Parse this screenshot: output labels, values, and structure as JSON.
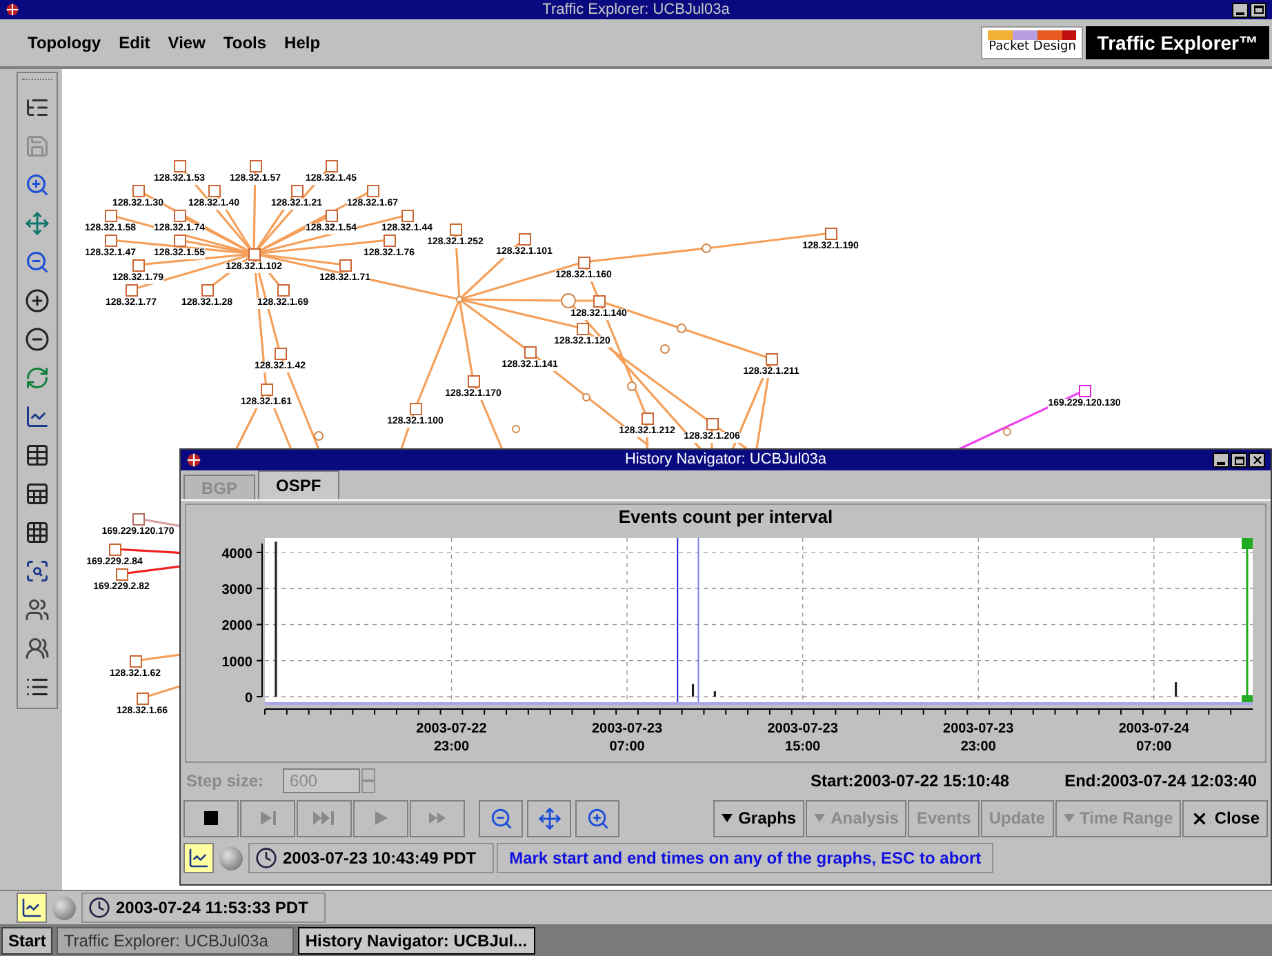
{
  "window": {
    "title": "Traffic Explorer: UCBJul03a"
  },
  "menu": [
    "Topology",
    "Edit",
    "View",
    "Tools",
    "Help"
  ],
  "logo": {
    "company": "Packet Design",
    "product": "Traffic Explorer™"
  },
  "toolbar": [
    {
      "kind": "tree",
      "disabled": false
    },
    {
      "kind": "save",
      "disabled": true
    },
    {
      "kind": "zoom-in",
      "disabled": false
    },
    {
      "kind": "fit",
      "disabled": false
    },
    {
      "kind": "zoom-out",
      "disabled": false
    },
    {
      "kind": "label-add",
      "disabled": false
    },
    {
      "kind": "label-remove",
      "disabled": false
    },
    {
      "kind": "refresh",
      "disabled": false
    },
    {
      "kind": "graph",
      "disabled": false
    },
    {
      "kind": "table",
      "disabled": false
    },
    {
      "kind": "table-link",
      "disabled": false
    },
    {
      "kind": "table-num",
      "disabled": false
    },
    {
      "kind": "inspect",
      "disabled": false
    },
    {
      "kind": "group",
      "disabled": false
    },
    {
      "kind": "group-path",
      "disabled": false
    },
    {
      "kind": "list",
      "disabled": false
    }
  ],
  "topology": {
    "nodes": [
      {
        "label": "128.32.1.102",
        "color": "#cc6633"
      },
      {
        "label": "128.32.1.53",
        "color": "#cc6633"
      },
      {
        "label": "128.32.1.57",
        "color": "#cc6633"
      },
      {
        "label": "128.32.1.45",
        "color": "#cc6633"
      },
      {
        "label": "128.32.1.30",
        "color": "#cc6633"
      },
      {
        "label": "128.32.1.40",
        "color": "#cc6633"
      },
      {
        "label": "128.32.1.21",
        "color": "#cc6633"
      },
      {
        "label": "128.32.1.67",
        "color": "#cc6633"
      },
      {
        "label": "128.32.1.58",
        "color": "#cc6633"
      },
      {
        "label": "128.32.1.74",
        "color": "#cc6633"
      },
      {
        "label": "128.32.1.54",
        "color": "#cc6633"
      },
      {
        "label": "128.32.1.44",
        "color": "#cc6633"
      },
      {
        "label": "128.32.1.47",
        "color": "#cc6633"
      },
      {
        "label": "128.32.1.55",
        "color": "#cc6633"
      },
      {
        "label": "128.32.1.76",
        "color": "#cc6633"
      },
      {
        "label": "128.32.1.79",
        "color": "#cc6633"
      },
      {
        "label": "128.32.1.71",
        "color": "#cc6633"
      },
      {
        "label": "128.32.1.77",
        "color": "#cc6633"
      },
      {
        "label": "128.32.1.28",
        "color": "#cc6633"
      },
      {
        "label": "128.32.1.69",
        "color": "#cc6633"
      },
      {
        "label": "128.32.1.42",
        "color": "#cc6633"
      },
      {
        "label": "128.32.1.61",
        "color": "#cc6633"
      },
      {
        "label": "128.32.1.252",
        "color": "#cc6633"
      },
      {
        "label": "128.32.1.101",
        "color": "#cc6633"
      },
      {
        "label": "128.32.1.160",
        "color": "#cc6633"
      },
      {
        "label": "128.32.1.190",
        "color": "#cc6633"
      },
      {
        "label": "128.32.1.140",
        "color": "#cc6633"
      },
      {
        "label": "128.32.1.120",
        "color": "#cc6633"
      },
      {
        "label": "128.32.1.141",
        "color": "#cc6633"
      },
      {
        "label": "128.32.1.211",
        "color": "#cc6633"
      },
      {
        "label": "128.32.1.170",
        "color": "#cc6633"
      },
      {
        "label": "128.32.1.100",
        "color": "#cc6633"
      },
      {
        "label": "128.32.1.212",
        "color": "#cc6633"
      },
      {
        "label": "128.32.1.206",
        "color": "#cc6633"
      },
      {
        "label": "169.229.120.130",
        "color": "#e020e0"
      },
      {
        "label": "169.229.120.170",
        "color": "#b07060"
      },
      {
        "label": "169.229.2.84",
        "color": "#cc6633"
      },
      {
        "label": "169.229.2.82",
        "color": "#cc6633"
      },
      {
        "label": "128.32.1.62",
        "color": "#cc6633"
      },
      {
        "label": "128.32.1.66",
        "color": "#cc6633"
      }
    ]
  },
  "navigator": {
    "title": "History Navigator: UCBJul03a",
    "tabs": [
      {
        "label": "BGP",
        "selected": false,
        "disabled": true
      },
      {
        "label": "OSPF",
        "selected": true,
        "disabled": false
      }
    ],
    "chart_data": {
      "type": "bar",
      "title": "Events count per interval",
      "categories": [
        null,
        null,
        null,
        null,
        null,
        null,
        null,
        null,
        "2003-07-22 23:00",
        null,
        null,
        null,
        null,
        null,
        null,
        null,
        "2003-07-23 07:00",
        null,
        null,
        null,
        null,
        null,
        null,
        null,
        "2003-07-23 15:00",
        null,
        null,
        null,
        null,
        null,
        null,
        null,
        "2003-07-23 23:00",
        null,
        null,
        null,
        null,
        null,
        null,
        null,
        "2003-07-24 07:00",
        null,
        null,
        null,
        null
      ],
      "values": [
        4300,
        null,
        null,
        null,
        null,
        null,
        null,
        null,
        null,
        null,
        null,
        null,
        null,
        null,
        null,
        null,
        null,
        null,
        null,
        350,
        150,
        null,
        null,
        null,
        null,
        null,
        null,
        null,
        null,
        null,
        null,
        null,
        null,
        null,
        null,
        null,
        null,
        null,
        null,
        null,
        null,
        400,
        null,
        null,
        null
      ],
      "ylim": [
        0,
        4400
      ],
      "yticks": [
        0,
        1000,
        2000,
        3000,
        4000
      ],
      "grid": true
    },
    "step": {
      "label": "Step size:",
      "value": "600",
      "disabled": true
    },
    "start": {
      "label": "Start:",
      "value": "2003-07-22 15:10:48"
    },
    "end": {
      "label": "End:",
      "value": "2003-07-24 12:03:40"
    },
    "playback": [
      {
        "kind": "stop",
        "disabled": false
      },
      {
        "kind": "step",
        "disabled": true
      },
      {
        "kind": "fast-step",
        "disabled": true
      },
      {
        "kind": "play",
        "disabled": true
      },
      {
        "kind": "fast-forward",
        "disabled": true
      }
    ],
    "zoom": [
      {
        "kind": "zoom-out"
      },
      {
        "kind": "fit"
      },
      {
        "kind": "zoom-in"
      }
    ],
    "actions": [
      {
        "label": "Graphs",
        "kind": "menu",
        "disabled": false
      },
      {
        "label": "Analysis",
        "kind": "menu",
        "disabled": true
      },
      {
        "label": "Events",
        "kind": "plain",
        "disabled": true
      },
      {
        "label": "Update",
        "kind": "plain",
        "disabled": true
      },
      {
        "label": "Time Range",
        "kind": "menu",
        "disabled": true
      },
      {
        "label": "Close",
        "kind": "close",
        "disabled": false
      }
    ],
    "status": {
      "graph_on": true,
      "time": "2003-07-23 10:43:49 PDT",
      "message": "Mark start and end times on any of the graphs, ESC to abort"
    }
  },
  "status_bar": {
    "graph_on": true,
    "time": "2003-07-24 11:53:33 PDT"
  },
  "taskbar": {
    "start": "Start",
    "items": [
      {
        "label": "Traffic Explorer: UCBJul03a",
        "selected": false
      },
      {
        "label": "History Navigator: UCBJul...",
        "selected": true
      }
    ]
  }
}
